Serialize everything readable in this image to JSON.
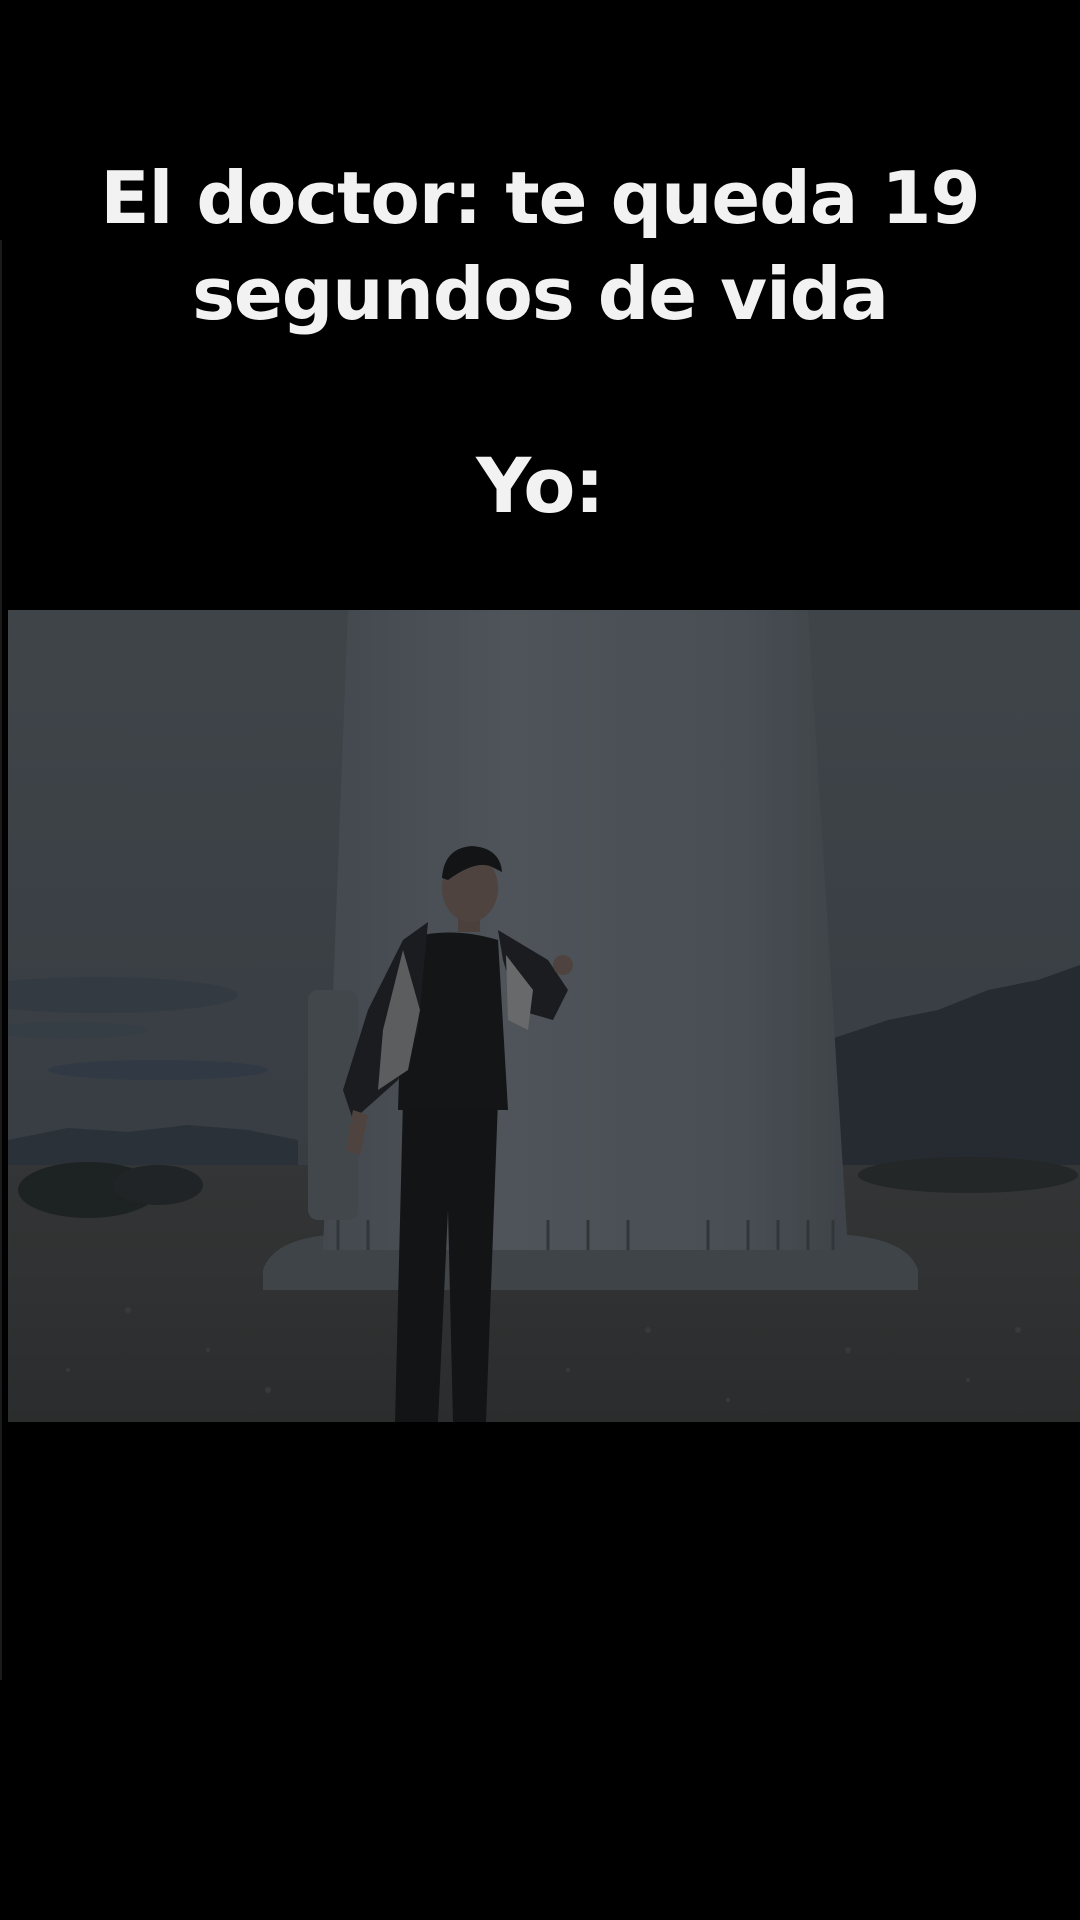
{
  "caption": {
    "line1": "El doctor: te queda  19",
    "line2": "segundos de vida",
    "reply": "Yo:"
  },
  "colors": {
    "background": "#000000",
    "caption_text": "#f2f2f2"
  }
}
